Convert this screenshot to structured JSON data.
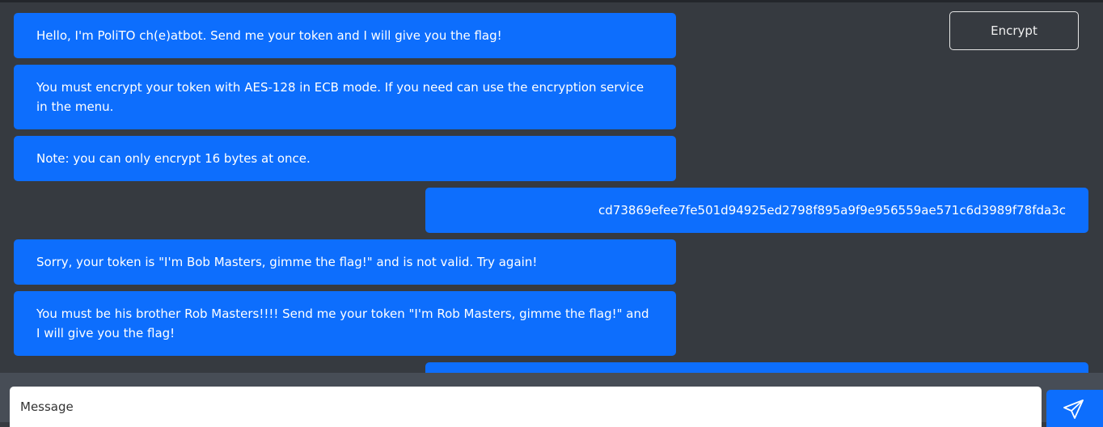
{
  "header": {
    "encrypt_label": "Encrypt"
  },
  "messages": [
    {
      "from": "bot",
      "text": "Hello, I'm PoliTO ch(e)atbot. Send me your token and I will give you the flag!"
    },
    {
      "from": "bot",
      "text": "You must encrypt your token with AES-128 in ECB mode. If you need can use the encryption service in the menu."
    },
    {
      "from": "bot",
      "text": "Note: you can only encrypt 16 bytes at once."
    },
    {
      "from": "user",
      "text": "cd73869efee7fe501d94925ed2798f895a9f9e956559ae571c6d3989f78fda3c"
    },
    {
      "from": "bot",
      "text": "Sorry, your token is \"I'm Bob Masters, gimme the flag!\" and is not valid. Try again!"
    },
    {
      "from": "bot",
      "text": "You must be his brother Rob Masters!!!! Send me your token \"I'm Rob Masters, gimme the flag!\" and I will give you the flag!"
    },
    {
      "from": "user",
      "text": ""
    }
  ],
  "composer": {
    "placeholder": "Message",
    "send_icon": "send-icon"
  },
  "colors": {
    "background": "#363a40",
    "bubble": "#0d6efd",
    "footer": "#474d56"
  }
}
